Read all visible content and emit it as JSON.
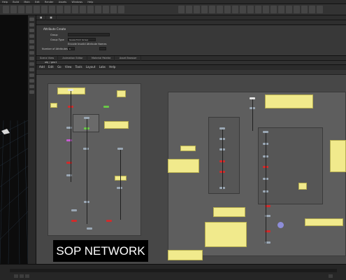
{
  "menubar": {
    "items": [
      "Help",
      "Build",
      "Main",
      "Edit",
      "Render",
      "Assets",
      "Windows",
      "Help"
    ]
  },
  "shelf": {
    "tool_groups": 22
  },
  "params": {
    "node_title": "Attribute Create",
    "fields": [
      {
        "label": "Group",
        "value": ""
      },
      {
        "label": "Group Type",
        "value": "Guess from Group"
      },
      {
        "label": "Number of Attributes",
        "value": "1"
      }
    ],
    "checkbox_label": "Encode Invalid Attribute Names"
  },
  "network": {
    "tabs": [
      "Scene View",
      "Animation Editor",
      "Material Palette",
      "Asset Browser"
    ],
    "path": "obj / geo1",
    "menu": [
      "Add",
      "Edit",
      "Go",
      "View",
      "Tools",
      "Layout",
      "Labs",
      "Help"
    ]
  },
  "caption": "SOP NETWORK",
  "colors": {
    "note": "#f1ea8c",
    "network_bg": "#474747",
    "node_red": "#d12b2b",
    "node_green": "#69c847",
    "node_pink": "#c65ad0"
  }
}
